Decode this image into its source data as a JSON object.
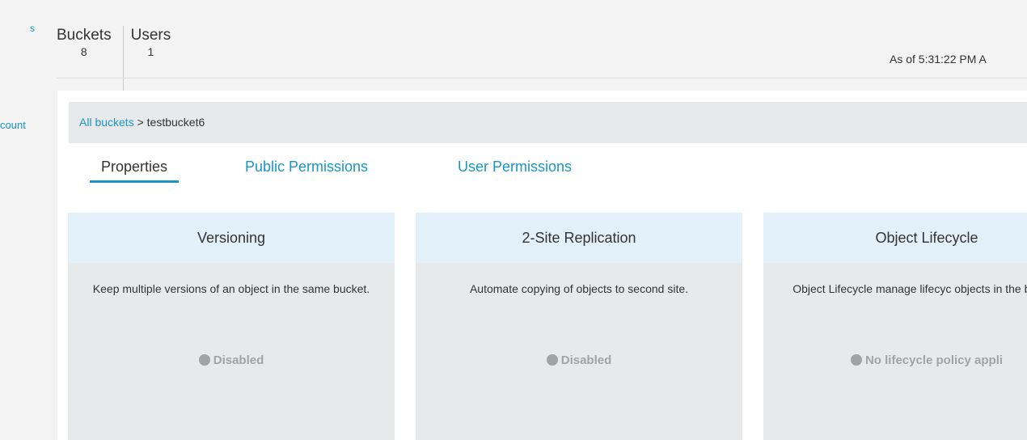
{
  "sidebar": {
    "items": [
      {
        "label": "s"
      },
      {
        "label": "count"
      }
    ]
  },
  "header": {
    "stats": [
      {
        "label": "Buckets",
        "value": "8"
      },
      {
        "label": "Users",
        "value": "1"
      }
    ],
    "as_of": "As of 5:31:22 PM A"
  },
  "breadcrumb": {
    "link": "All buckets",
    "separator": " > ",
    "current": "testbucket6"
  },
  "tabs": [
    {
      "label": "Properties",
      "active": true
    },
    {
      "label": "Public Permissions",
      "active": false
    },
    {
      "label": "User Permissions",
      "active": false
    }
  ],
  "cards": [
    {
      "title": "Versioning",
      "description": "Keep multiple versions of an object in the same bucket.",
      "status": "Disabled",
      "icon": "status-dot-icon"
    },
    {
      "title": "2-Site Replication",
      "description": "Automate copying of objects to second site.",
      "status": "Disabled",
      "icon": "status-dot-icon"
    },
    {
      "title": "Object Lifecycle",
      "description": "Object Lifecycle manage lifecyc objects in the bucket.",
      "status": "No lifecycle policy appli",
      "icon": "status-dot-icon"
    }
  ],
  "colors": {
    "accent": "#1a95c6",
    "card_header": "#e1f0f9",
    "card_body": "#e8e9ea",
    "status_gray": "#a3a3a3"
  }
}
